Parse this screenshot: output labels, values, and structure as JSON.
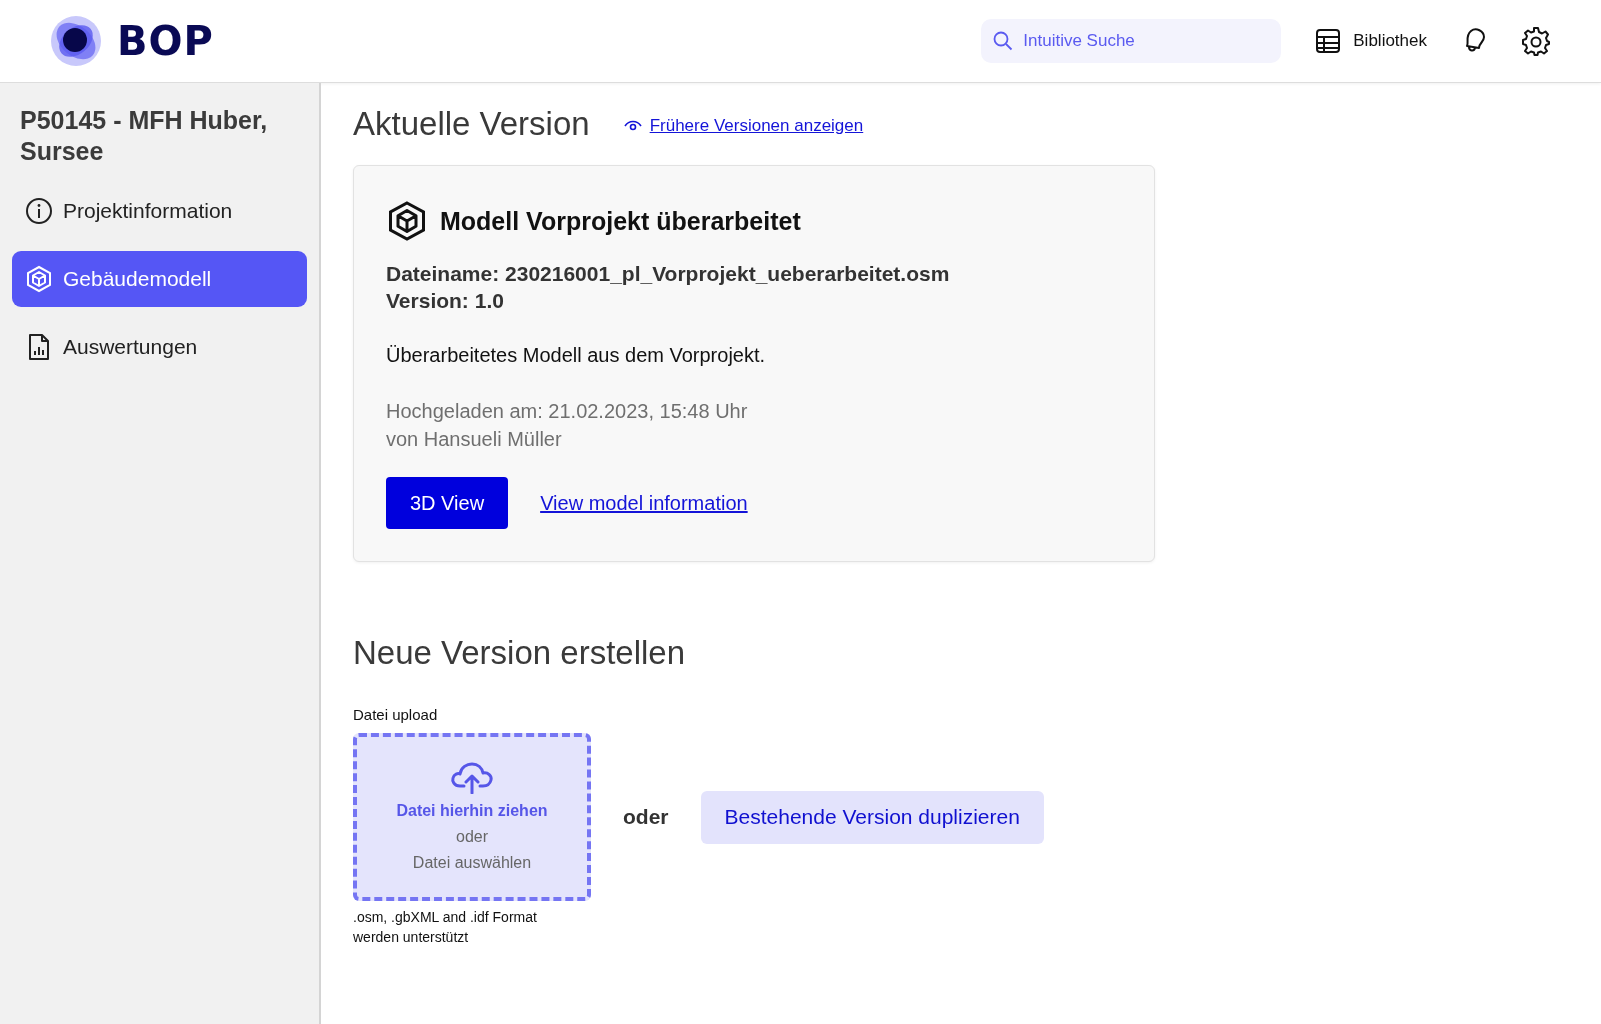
{
  "header": {
    "logo": "BOP",
    "search": {
      "placeholder": "Intuitive Suche"
    },
    "library": "Bibliothek"
  },
  "sidebar": {
    "project_title": "P50145 - MFH Huber, Sursee",
    "items": [
      {
        "kind": "info",
        "label": "Projektinformation",
        "selected": false
      },
      {
        "kind": "model",
        "label": "Gebäudemodell",
        "selected": true
      },
      {
        "kind": "report",
        "label": "Auswertungen",
        "selected": false
      }
    ]
  },
  "current_version": {
    "heading": "Aktuelle Version",
    "history_link": "Frühere Versionen anzeigen",
    "card": {
      "title": "Modell Vorprojekt überarbeitet",
      "filename": "Dateiname: 230216001_pl_Vorprojekt_ueberarbeitet.osm",
      "version": "Version: 1.0",
      "description": "Überarbeitetes Modell aus dem Vorprojekt.",
      "uploaded": "Hochgeladen am: 21.02.2023, 15:48 Uhr",
      "uploader": "von Hansueli Müller",
      "view_button": "3D View",
      "info_link": "View model information"
    }
  },
  "new_version": {
    "heading": "Neue Version erstellen",
    "upload_label": "Datei upload",
    "drop_text": "Datei hierhin ziehen",
    "drop_or": "oder",
    "choose_text": "Datei auswählen",
    "formats_note": ".osm, .gbXML and .idf Format werden unterstützt",
    "or": "oder",
    "duplicate_button": "Bestehende Version duplizieren"
  }
}
